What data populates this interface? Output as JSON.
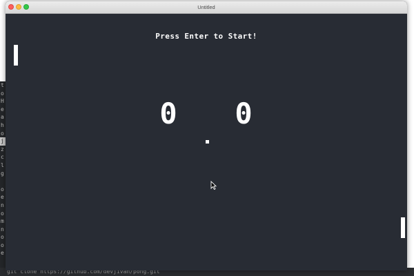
{
  "window": {
    "title": "Untitled"
  },
  "game": {
    "start_message": "Press Enter to Start!",
    "score_left": "0",
    "score_right": "0",
    "background_color": "#282c34",
    "foreground_color": "#ffffff"
  },
  "terminal": {
    "status_line": "git clone https://github.com/devjivan/pong.git",
    "left_fragments": [
      "t",
      "o",
      "H",
      "e",
      "a",
      "h",
      "o",
      "j",
      "z",
      "c",
      "l",
      "g",
      "",
      "o",
      "e",
      "n",
      "o",
      "m",
      "n",
      "o",
      "o",
      "e"
    ]
  }
}
